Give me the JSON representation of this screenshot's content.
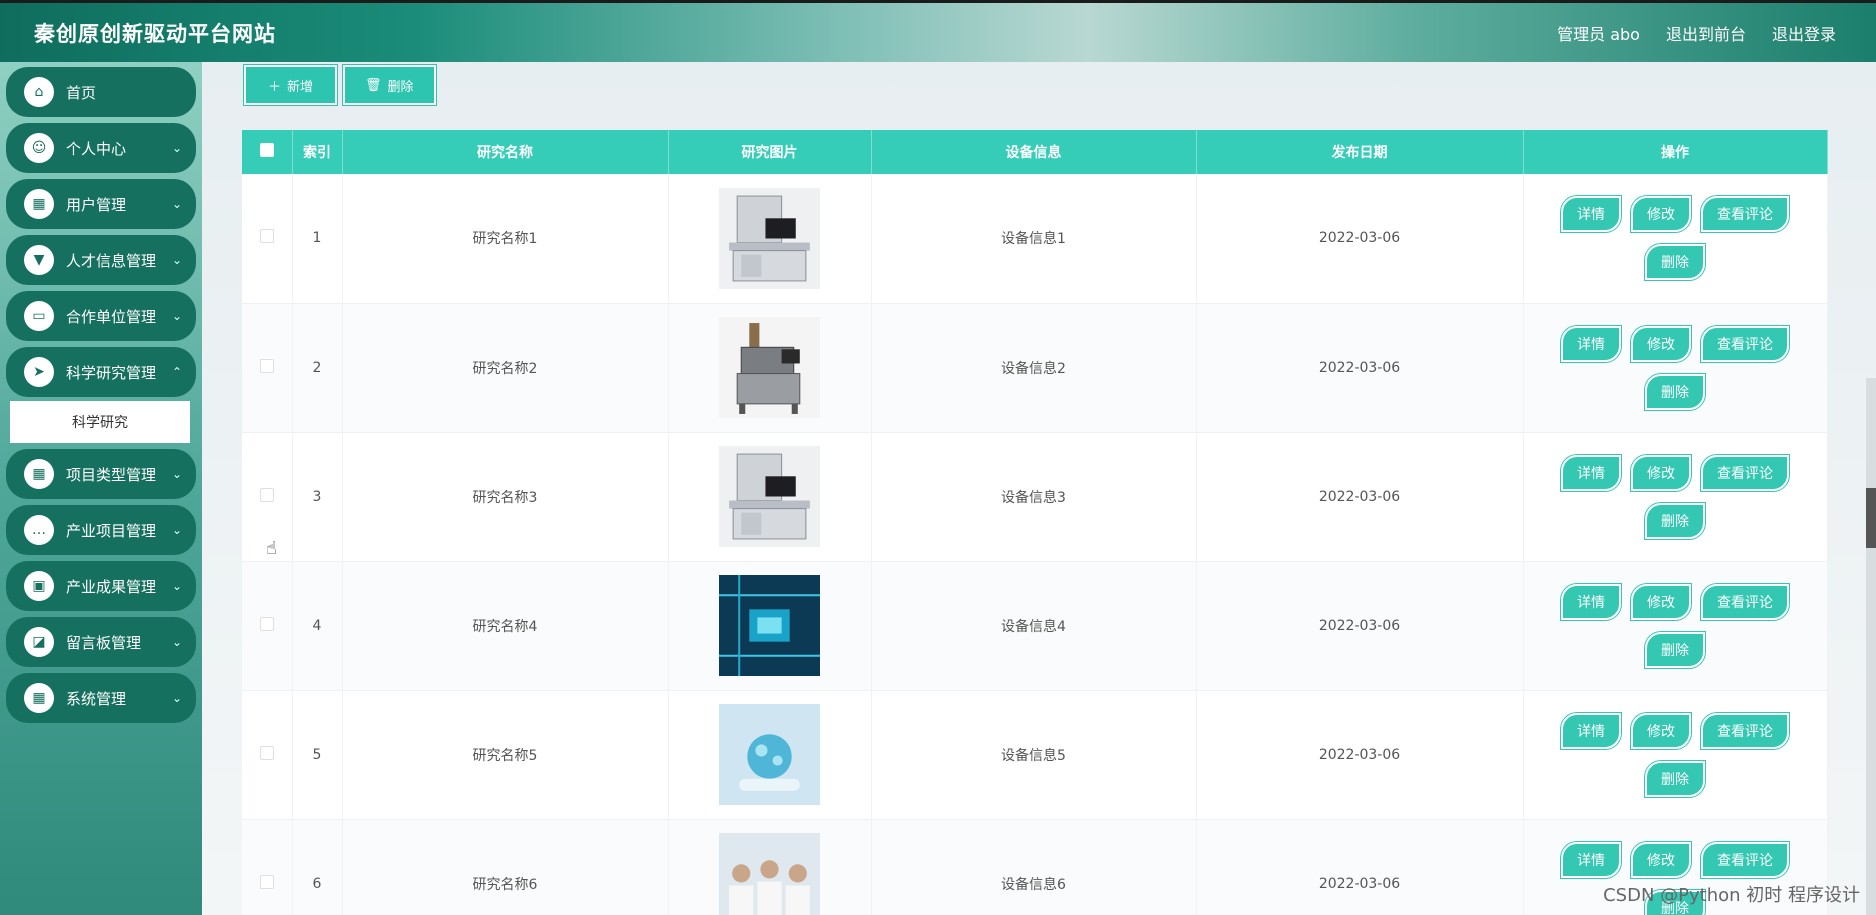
{
  "header": {
    "title": "秦创原创新驱动平台网站",
    "admin": "管理员 abo",
    "to_front": "退出到前台",
    "logout": "退出登录"
  },
  "sidebar": {
    "items": [
      {
        "label": "首页",
        "icon": "⌂"
      },
      {
        "label": "个人中心",
        "icon": "☺"
      },
      {
        "label": "用户管理",
        "icon": "▦"
      },
      {
        "label": "人才信息管理",
        "icon": "▼"
      },
      {
        "label": "合作单位管理",
        "icon": "▭"
      },
      {
        "label": "科学研究管理",
        "icon": "➤"
      },
      {
        "label": "项目类型管理",
        "icon": "▦"
      },
      {
        "label": "产业项目管理",
        "icon": "…"
      },
      {
        "label": "产业成果管理",
        "icon": "▣"
      },
      {
        "label": "留言板管理",
        "icon": "◪"
      },
      {
        "label": "系统管理",
        "icon": "▦"
      }
    ],
    "sub_item": "科学研究"
  },
  "toolbar": {
    "add_label": "新增",
    "delete_label": "删除"
  },
  "table": {
    "headers": [
      "索引",
      "研究名称",
      "研究图片",
      "设备信息",
      "发布日期",
      "操作"
    ],
    "rows": [
      {
        "index": "1",
        "name": "研究名称1",
        "device": "设备信息1",
        "date": "2022-03-06",
        "img": "machine-a"
      },
      {
        "index": "2",
        "name": "研究名称2",
        "device": "设备信息2",
        "date": "2022-03-06",
        "img": "machine-b"
      },
      {
        "index": "3",
        "name": "研究名称3",
        "device": "设备信息3",
        "date": "2022-03-06",
        "img": "machine-a"
      },
      {
        "index": "4",
        "name": "研究名称4",
        "device": "设备信息4",
        "date": "2022-03-06",
        "img": "circuit"
      },
      {
        "index": "5",
        "name": "研究名称5",
        "device": "设备信息5",
        "date": "2022-03-06",
        "img": "lab"
      },
      {
        "index": "6",
        "name": "研究名称6",
        "device": "设备信息6",
        "date": "2022-03-06",
        "img": "team"
      }
    ],
    "ops": {
      "detail": "详情",
      "edit": "修改",
      "comments": "查看评论",
      "delete": "删除"
    }
  },
  "watermark": "CSDN @Python 初时 程序设计"
}
